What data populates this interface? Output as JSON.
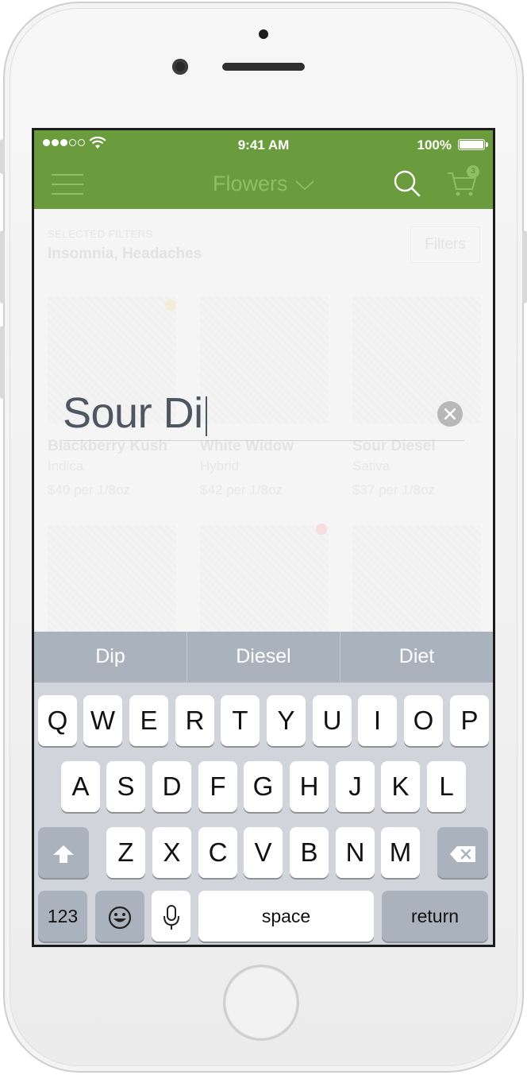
{
  "status_bar": {
    "time": "9:41 AM",
    "battery": "100%"
  },
  "header": {
    "title": "Flowers",
    "cart_count": "3"
  },
  "filters_bar": {
    "label": "SELECTED FILTERS",
    "value": "Insomnia, Headaches",
    "button": "Filters"
  },
  "products": [
    {
      "name": "Blackberry Kush",
      "type": "Indica",
      "price": "$40 per 1/8oz"
    },
    {
      "name": "White Widow",
      "type": "Hybrid",
      "price": "$42 per 1/8oz"
    },
    {
      "name": "Sour Diesel",
      "type": "Sativa",
      "price": "$37 per 1/8oz"
    }
  ],
  "search": {
    "value": "Sour Di"
  },
  "keyboard": {
    "suggestions": [
      "Dip",
      "Diesel",
      "Diet"
    ],
    "row1": [
      "Q",
      "W",
      "E",
      "R",
      "T",
      "Y",
      "U",
      "I",
      "O",
      "P"
    ],
    "row2": [
      "A",
      "S",
      "D",
      "F",
      "G",
      "H",
      "J",
      "K",
      "L"
    ],
    "row3": [
      "Z",
      "X",
      "C",
      "V",
      "B",
      "N",
      "M"
    ],
    "numbers": "123",
    "space": "space",
    "return": "return"
  },
  "colors": {
    "header_green": "#6a9b3c",
    "header_icons": "#8fbf62",
    "keyboard_bg": "#d1d5db",
    "suggestion_bg": "#aab3bd"
  }
}
